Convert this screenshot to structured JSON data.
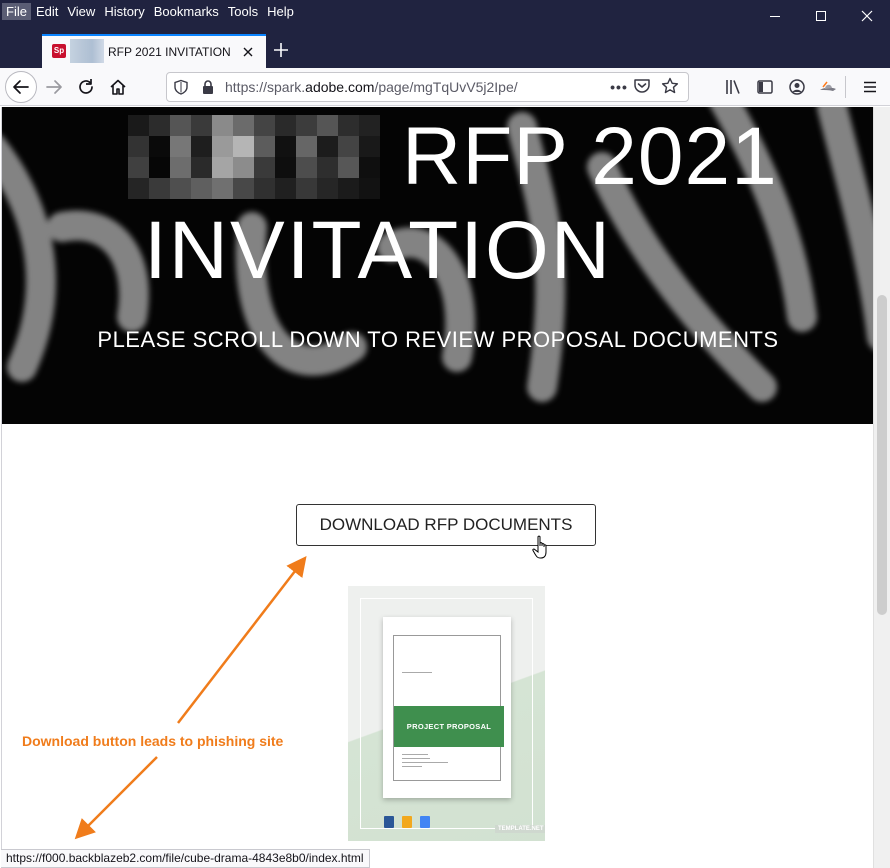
{
  "menu": {
    "items": [
      "File",
      "Edit",
      "View",
      "History",
      "Bookmarks",
      "Tools",
      "Help"
    ],
    "active_index": 0
  },
  "window_controls": [
    "minimize-icon",
    "maximize-icon",
    "close-icon"
  ],
  "tab": {
    "title": "RFP 2021 INVITATION",
    "favicon_text": "Sp",
    "favicon_color": "#c8102e"
  },
  "navbar": {
    "url_prefix": "https://spark.",
    "url_domain": "adobe.com",
    "url_path": "/page/mgTqUvV5j2Ipe/",
    "more_label": "•••"
  },
  "hero": {
    "title_line1": "RFP 2021",
    "title_line2": "INVITATION",
    "subtitle": "PLEASE SCROLL DOWN TO REVIEW PROPOSAL DOCUMENTS"
  },
  "main": {
    "download_button": "DOWNLOAD RFP DOCUMENTS",
    "doc_thumbnail": {
      "band_text": "PROJECT PROPOSAL",
      "watermark": "TEMPLATE.NET"
    }
  },
  "annotation": {
    "text": "Download button leads to phishing site",
    "color": "#f07c1b"
  },
  "status_bar": {
    "url": "https://f000.backblazeb2.com/file/cube-drama-4843e8b0/index.html"
  },
  "colors": {
    "titlebar": "#202340",
    "tab_accent": "#0a84ff",
    "hero_bg": "#040404"
  }
}
